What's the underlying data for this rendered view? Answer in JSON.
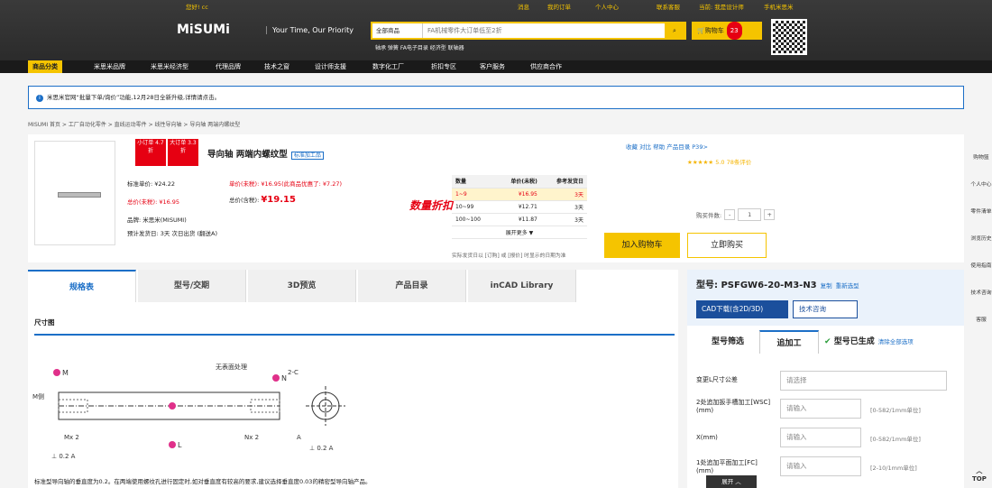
{
  "header": {
    "greeting": "您好! cc",
    "msg": "消息",
    "orders": "我的订单",
    "center": "个人中心",
    "service": "联系客服",
    "designer": "当前: 我是设计师",
    "mobile": "手机米思米",
    "logo": "MiSUMi",
    "tagline": "Your Time, Our Priority",
    "search_cat": "全部商品",
    "search_placeholder": "FA机械零件大订单低至2折",
    "hot": "轴承 弹簧 FA电子目录 经济型 联轴器",
    "cart": "购物车",
    "cart_count": "23",
    "qr_text": "MISUMI"
  },
  "nav": {
    "items": [
      "商品分类",
      "米思米品牌",
      "米思米经济型",
      "代理品牌",
      "技术之窗",
      "设计师支援",
      "数字化工厂",
      "折扣专区",
      "客户服务",
      "供应商合作"
    ]
  },
  "notice": "米思米官网“批量下单/询价”功能,12月28日全新升级,详情请点击。",
  "breadcrumb": "MISUMI 首页 > 工厂自动化零件 > 直线运动零件 > 线性导向轴 > 导向轴 两端内螺纹型",
  "product": {
    "badge1": "小订单 4.7折",
    "badge2": "大订单 3.3折",
    "title": "导向轴 两端内螺纹型",
    "tag": "标准加工品",
    "std_price": "标准单价: ¥24.22",
    "unit_price": "单价(未税): ¥16.95(此商品优惠了: ¥7.27)",
    "total_untax": "总价(未税): ¥16.95",
    "total_tax_label": "总价(含税):",
    "total_tax": "¥19.15",
    "brand": "品牌: 米思米(MISUMI)",
    "ship": "预计发货日: 3天 次日出货 (翻送A)",
    "discount": "数量折扣",
    "actions": "收藏 对比 帮助 产品目录 P39>",
    "rating": "★★★★★ 5.0 78条评价",
    "qty_label": "购买件数:",
    "qty": "1",
    "add_cart": "加入购物车",
    "buy_now": "立即购买"
  },
  "price_table": {
    "headers": [
      "数量",
      "单价(未税)",
      "参考发货日"
    ],
    "rows": [
      [
        "1~9",
        "¥16.95",
        "3天"
      ],
      [
        "10~99",
        "¥12.71",
        "3天"
      ],
      [
        "100~100",
        "¥11.87",
        "3天"
      ]
    ],
    "more": "展开更多 ▼",
    "note": "实际发货日以 [订购] 或 [报价] 时显示的日期为准"
  },
  "tabs": [
    "规格表",
    "型号/交期",
    "3D预览",
    "产品目录",
    "inCAD Library"
  ],
  "section": "尺寸图",
  "drawing": {
    "m": "M",
    "n": "N",
    "l": "L",
    "d": "D",
    "mside": "M侧",
    "note1": "无表面处理",
    "c": "2-C",
    "mx": "Mx 2",
    "nx": "Nx 2",
    "a": "A",
    "tol1": "⊥ 0.2 A",
    "tol2": "⊥ 0.2 A"
  },
  "footnote": "标准型导向轴的垂直度为0.2。在两端使用螺纹孔进行固定时,如对垂直度有较高的要求,建议选择垂直度0.03的精密型导向轴产品。",
  "model": {
    "label": "型号: PSFGW6-20-M3-N3",
    "copy": "复制",
    "reselect": "重新选型",
    "cad": "CAD下载(含2D/3D)",
    "tech": "技术咨询"
  },
  "rtabs": {
    "filter": "型号筛选",
    "extra": "追加工",
    "done": "型号已生成",
    "clear": "清除全部选项"
  },
  "options": [
    {
      "label": "变更L尺寸公差",
      "value": "请选择"
    },
    {
      "label": "2处追加扳手槽加工[WSC](mm)",
      "value": "请输入",
      "hint": "[0-582/1mm单位]"
    },
    {
      "label": "X(mm)",
      "value": "请输入",
      "hint": "[0-582/1mm单位]"
    },
    {
      "label": "1处追加平面加工[FC](mm)",
      "value": "请输入",
      "hint": "[2-10/1mm单位]"
    }
  ],
  "expand": "展开 ︿",
  "sidebar": [
    "购物篮",
    "个人中心",
    "零件清单",
    "浏览历史",
    "使用指南",
    "技术咨询",
    "客服"
  ],
  "top": "TOP"
}
